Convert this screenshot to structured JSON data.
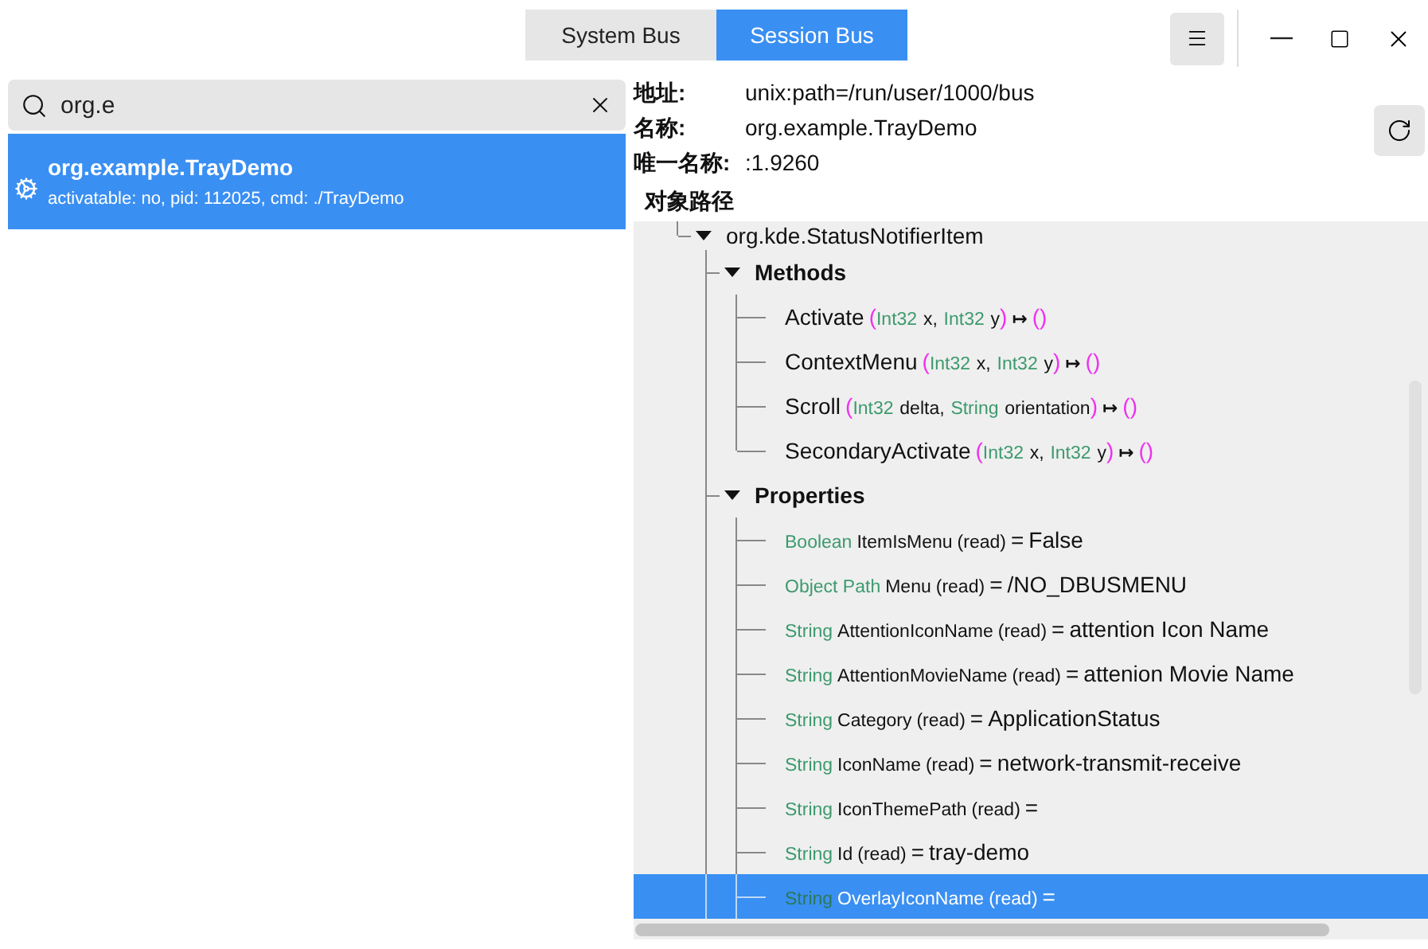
{
  "tabs": [
    {
      "label": "System Bus",
      "selected": false
    },
    {
      "label": "Session Bus",
      "selected": true
    }
  ],
  "search": {
    "value": "org.e"
  },
  "services": [
    {
      "name": "org.example.TrayDemo",
      "details": "activatable: no, pid: 112025, cmd: ./TrayDemo",
      "selected": true
    }
  ],
  "info": [
    {
      "label": "地址:",
      "value": "unix:path=/run/user/1000/bus"
    },
    {
      "label": "名称:",
      "value": "org.example.TrayDemo"
    },
    {
      "label": "唯一名称:",
      "value": ":1.9260"
    }
  ],
  "object_path_heading": "对象路径",
  "tree": {
    "label": "org.kde.StatusNotifierItem",
    "expanded": true,
    "children": [
      {
        "label": "Methods",
        "expanded": true,
        "children": [
          {
            "kind": "method",
            "name": "Activate",
            "open": "(",
            "args": [
              {
                "type": "Int32",
                "name": "x,"
              },
              {
                "type": "Int32",
                "name": "y"
              }
            ],
            "close": ")",
            "maps_to": "↦",
            "returns": "()",
            "selected": false
          },
          {
            "kind": "method",
            "name": "ContextMenu",
            "open": "(",
            "args": [
              {
                "type": "Int32",
                "name": "x,"
              },
              {
                "type": "Int32",
                "name": "y"
              }
            ],
            "close": ")",
            "maps_to": "↦",
            "returns": "()",
            "selected": false
          },
          {
            "kind": "method",
            "name": "Scroll",
            "open": "(",
            "args": [
              {
                "type": "Int32",
                "name": "delta,"
              },
              {
                "type": "String",
                "name": "orientation"
              }
            ],
            "close": ")",
            "maps_to": "↦",
            "returns": "()",
            "selected": false
          },
          {
            "kind": "method",
            "name": "SecondaryActivate",
            "open": "(",
            "args": [
              {
                "type": "Int32",
                "name": "x,"
              },
              {
                "type": "Int32",
                "name": "y"
              }
            ],
            "close": ")",
            "maps_to": "↦",
            "returns": "()",
            "selected": false
          }
        ]
      },
      {
        "label": "Properties",
        "expanded": true,
        "children": [
          {
            "kind": "property",
            "type": "Boolean",
            "name": "ItemIsMenu",
            "access": "(read)",
            "equals": "=",
            "value": "False",
            "selected": false
          },
          {
            "kind": "property",
            "type": "Object Path",
            "name": "Menu",
            "access": "(read)",
            "equals": "=",
            "value": "/NO_DBUSMENU",
            "selected": false
          },
          {
            "kind": "property",
            "type": "String",
            "name": "AttentionIconName",
            "access": "(read)",
            "equals": "=",
            "value": "attention Icon Name",
            "selected": false
          },
          {
            "kind": "property",
            "type": "String",
            "name": "AttentionMovieName",
            "access": "(read)",
            "equals": "=",
            "value": "attenion Movie Name",
            "selected": false
          },
          {
            "kind": "property",
            "type": "String",
            "name": "Category",
            "access": "(read)",
            "equals": "=",
            "value": "ApplicationStatus",
            "selected": false
          },
          {
            "kind": "property",
            "type": "String",
            "name": "IconName",
            "access": "(read)",
            "equals": "=",
            "value": "network-transmit-receive",
            "selected": false
          },
          {
            "kind": "property",
            "type": "String",
            "name": "IconThemePath",
            "access": "(read)",
            "equals": "=",
            "selected": false
          },
          {
            "kind": "property",
            "type": "String",
            "name": "Id",
            "access": "(read)",
            "equals": "=",
            "value": "tray-demo",
            "selected": false
          },
          {
            "kind": "property",
            "type": "String",
            "name": "OverlayIconName",
            "access": "(read)",
            "equals": "=",
            "selected": true
          }
        ]
      }
    ]
  }
}
